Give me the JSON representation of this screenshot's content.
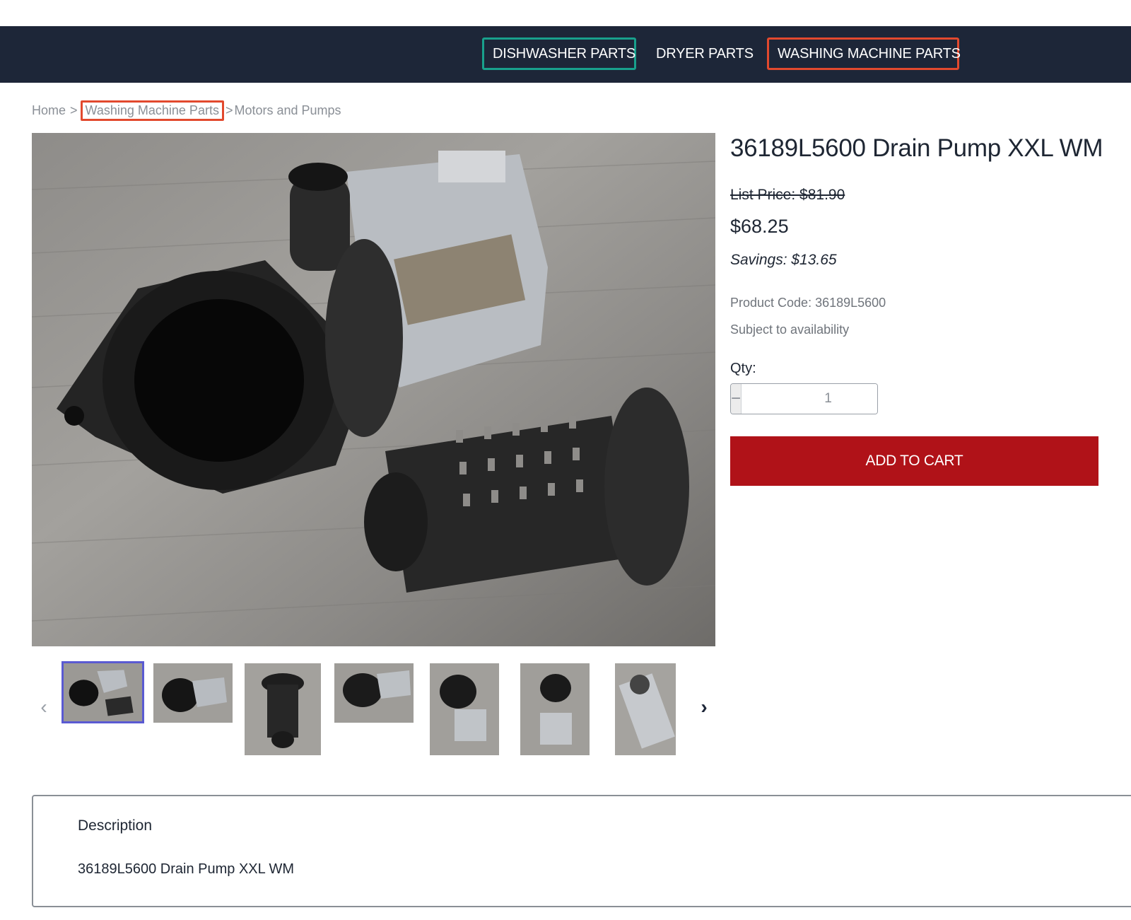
{
  "nav": {
    "items": [
      {
        "label": "DISHWASHER PARTS"
      },
      {
        "label": "DRYER PARTS"
      },
      {
        "label": "WASHING MACHINE PARTS"
      }
    ]
  },
  "breadcrumb": {
    "home": "Home",
    "separator": ">",
    "category": "Washing Machine Parts",
    "subcategory": "Motors and Pumps"
  },
  "product": {
    "title": "36189L5600 Drain Pump XXL WM",
    "list_price": "List Price: $81.90",
    "price": "$68.25",
    "savings": "Savings: $13.65",
    "product_code": "Product Code: 36189L5600",
    "availability": "Subject to availability",
    "qty_label": "Qty:",
    "qty_value": "1",
    "qty_minus": "−",
    "qty_plus": "+",
    "add_to_cart": "ADD TO CART"
  },
  "gallery": {
    "prev_icon": "chevron-left-icon",
    "next_icon": "chevron-right-icon",
    "thumbnail_count": 7,
    "active_index": 0
  },
  "description": {
    "heading": "Description",
    "text": "36189L5600 Drain Pump XXL WM"
  },
  "colors": {
    "nav_bg": "#1d2638",
    "add_to_cart_bg": "#b01218",
    "highlight_teal": "#18a08c",
    "highlight_orange": "#e2492e",
    "active_thumb_border": "#5a5ad2"
  }
}
